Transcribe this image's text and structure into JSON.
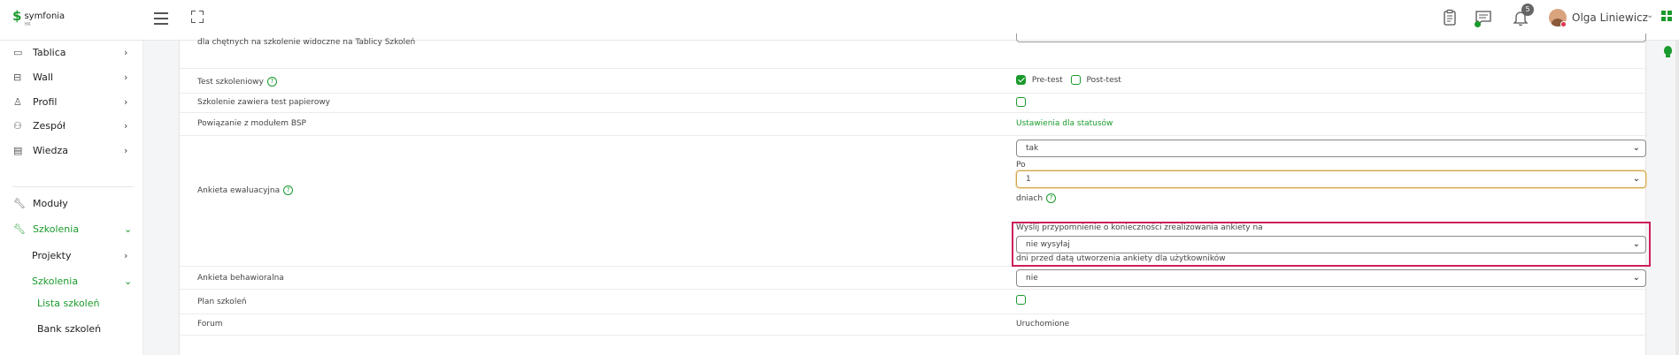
{
  "app": {
    "logo_text": "symfonia",
    "logo_subtext": "HR"
  },
  "header": {
    "notification_count": "5",
    "user_name": "Olga Liniewicz"
  },
  "sidebar": {
    "items": [
      {
        "label": "Tablica",
        "icon": "monitor-icon"
      },
      {
        "label": "Wall",
        "icon": "wall-icon"
      },
      {
        "label": "Profil",
        "icon": "user-icon"
      },
      {
        "label": "Zespół",
        "icon": "team-icon"
      },
      {
        "label": "Wiedza",
        "icon": "document-icon"
      },
      {
        "label": "Moduły",
        "icon": "wrench-icon"
      },
      {
        "label": "Szkolenia",
        "icon": "wrench-icon"
      },
      {
        "label": "Projekty"
      },
      {
        "label": "Szkolenia"
      },
      {
        "label": "Lista szkoleń"
      },
      {
        "label": "Bank szkoleń"
      }
    ]
  },
  "form": {
    "top_row_text": "dla chętnych na szkolenie widoczne na Tablicy Szkoleń",
    "rows": {
      "test": {
        "label": "Test szkoleniowy",
        "opt1": "Pre-test",
        "opt2": "Post-test"
      },
      "paper": {
        "label": "Szkolenie zawiera test papierowy"
      },
      "bsp": {
        "label": "Powiązanie z modułem BSP",
        "link": "Ustawienia dla statusów"
      },
      "survey": {
        "label": "Ankieta ewaluacyjna",
        "select1": "tak",
        "po_label": "Po",
        "select2": "1",
        "days_label": "dniach",
        "reminder_label": "Wyślij przypomnienie o konieczności zrealizowania ankiety na",
        "select3": "nie wysyłaj",
        "reminder_suffix": "dni przed datą utworzenia ankiety dla użytkowników"
      },
      "behavioral": {
        "label": "Ankieta behawioralna",
        "select": "nie"
      },
      "plan": {
        "label": "Plan szkoleń"
      },
      "forum": {
        "label": "Forum",
        "value": "Uruchomione"
      }
    }
  },
  "colors": {
    "accent": "#1a9a2c",
    "highlight": "#cc1f5a"
  }
}
